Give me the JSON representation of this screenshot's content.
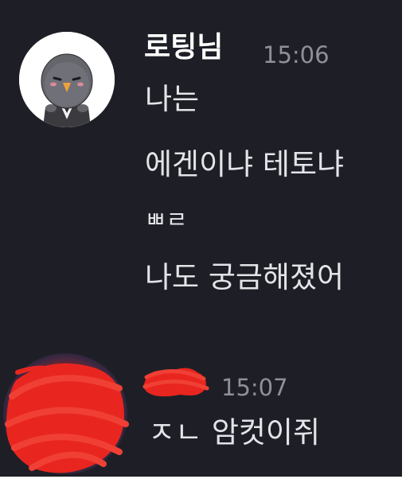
{
  "messages_block_1": {
    "username": "로팅님",
    "time": "15:06",
    "lines": [
      "나는",
      "에겐이냐 테토냐",
      "ㅃㄹ",
      "나도 궁금해졌어"
    ]
  },
  "messages_block_2": {
    "username_redacted": true,
    "time": "15:07",
    "lines": [
      "ㅈㄴ 암컷이쥐"
    ]
  },
  "colors": {
    "background": "#1e1f26",
    "message_text": "#e3e4e8",
    "username_text": "#ffffff",
    "timestamp_text": "#8f9098",
    "redaction_scribble": "#e8261f"
  },
  "icons": {
    "avatar_1": "pigeon-avatar-icon"
  }
}
